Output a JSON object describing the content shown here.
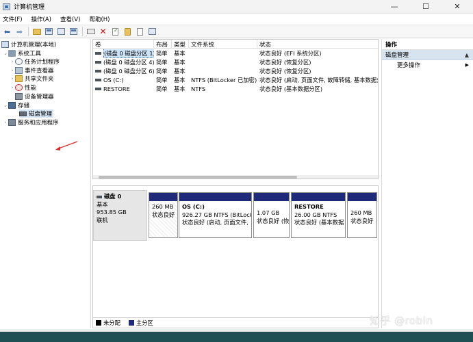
{
  "window": {
    "title": "计算机管理",
    "controls": {
      "minimize": "—",
      "maximize": "☐",
      "close": "✕"
    }
  },
  "menu": [
    "文件(F)",
    "操作(A)",
    "查看(V)",
    "帮助(H)"
  ],
  "toolbar": {
    "icons": [
      "back-icon",
      "forward-icon",
      "up-folder-icon",
      "properties-icon",
      "help-icon",
      "connect-icon",
      "delete-icon",
      "check-icon",
      "folder-icon",
      "doc-icon",
      "view-icon"
    ]
  },
  "tree": {
    "root": "计算机管理(本地)",
    "system_tools": "系统工具",
    "items": [
      "任务计划程序",
      "事件查看器",
      "共享文件夹",
      "性能",
      "设备管理器"
    ],
    "storage": "存储",
    "disk_management": "磁盘管理",
    "services": "服务和应用程序"
  },
  "volumes": {
    "headers": [
      "卷",
      "布局",
      "类型",
      "文件系统",
      "状态"
    ],
    "rows": [
      {
        "volume": "(磁盘 0 磁盘分区 1)",
        "layout": "简单",
        "type": "基本",
        "fs": "",
        "status": "状态良好 (EFI 系统分区)"
      },
      {
        "volume": "(磁盘 0 磁盘分区 4)",
        "layout": "简单",
        "type": "基本",
        "fs": "",
        "status": "状态良好 (恢复分区)"
      },
      {
        "volume": "(磁盘 0 磁盘分区 6)",
        "layout": "简单",
        "type": "基本",
        "fs": "",
        "status": "状态良好 (恢复分区)"
      },
      {
        "volume": "OS (C:)",
        "layout": "简单",
        "type": "基本",
        "fs": "NTFS (BitLocker 已加密)",
        "status": "状态良好 (启动, 页面文件, 故障转储, 基本数据分"
      },
      {
        "volume": "RESTORE",
        "layout": "简单",
        "type": "基本",
        "fs": "NTFS",
        "status": "状态良好 (基本数据分区)"
      }
    ]
  },
  "disk": {
    "name": "磁盘 0",
    "type": "基本",
    "size": "953.85 GB",
    "state": "联机",
    "partitions": [
      {
        "name": "",
        "size": "260 MB",
        "status": "状态良好"
      },
      {
        "name": "OS  (C:)",
        "size": "926.27 GB NTFS (BitLocke",
        "status": "状态良好 (启动, 页面文件,"
      },
      {
        "name": "",
        "size": "1.07 GB",
        "status": "状态良好 (恢"
      },
      {
        "name": "RESTORE",
        "size": "26.00 GB NTFS",
        "status": "状态良好 (基本数据"
      },
      {
        "name": "",
        "size": "260 MB",
        "status": "状态良好"
      }
    ]
  },
  "legend": [
    {
      "label": "未分配",
      "color": "#000000"
    },
    {
      "label": "主分区",
      "color": "#1f2a7a"
    }
  ],
  "actions": {
    "title": "操作",
    "section": "磁盘管理",
    "more": "更多操作"
  },
  "watermark": "知乎 @robin",
  "colors": {
    "partition_bar": "#1f2a7a",
    "selection": "#cce3f8",
    "annotation": "#d92b2b"
  }
}
